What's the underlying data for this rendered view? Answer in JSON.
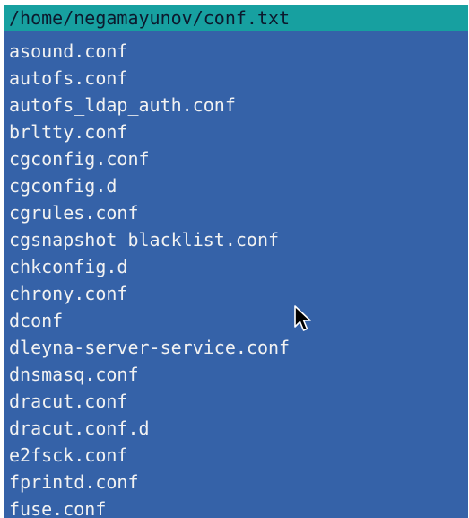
{
  "header": {
    "file_path": "/home/negamayunov/conf.txt"
  },
  "lines": [
    "asound.conf",
    "autofs.conf",
    "autofs_ldap_auth.conf",
    "brltty.conf",
    "cgconfig.conf",
    "cgconfig.d",
    "cgrules.conf",
    "cgsnapshot_blacklist.conf",
    "chkconfig.d",
    "chrony.conf",
    "dconf",
    "dleyna-server-service.conf",
    "dnsmasq.conf",
    "dracut.conf",
    "dracut.conf.d",
    "e2fsck.conf",
    "fprintd.conf",
    "fuse.conf"
  ],
  "colors": {
    "background": "#3562a8",
    "title_bar": "#17a0a0",
    "text": "#f2f2f2",
    "title_text": "#0c1a2e"
  },
  "icons": {
    "cursor": "mouse-pointer-icon"
  }
}
